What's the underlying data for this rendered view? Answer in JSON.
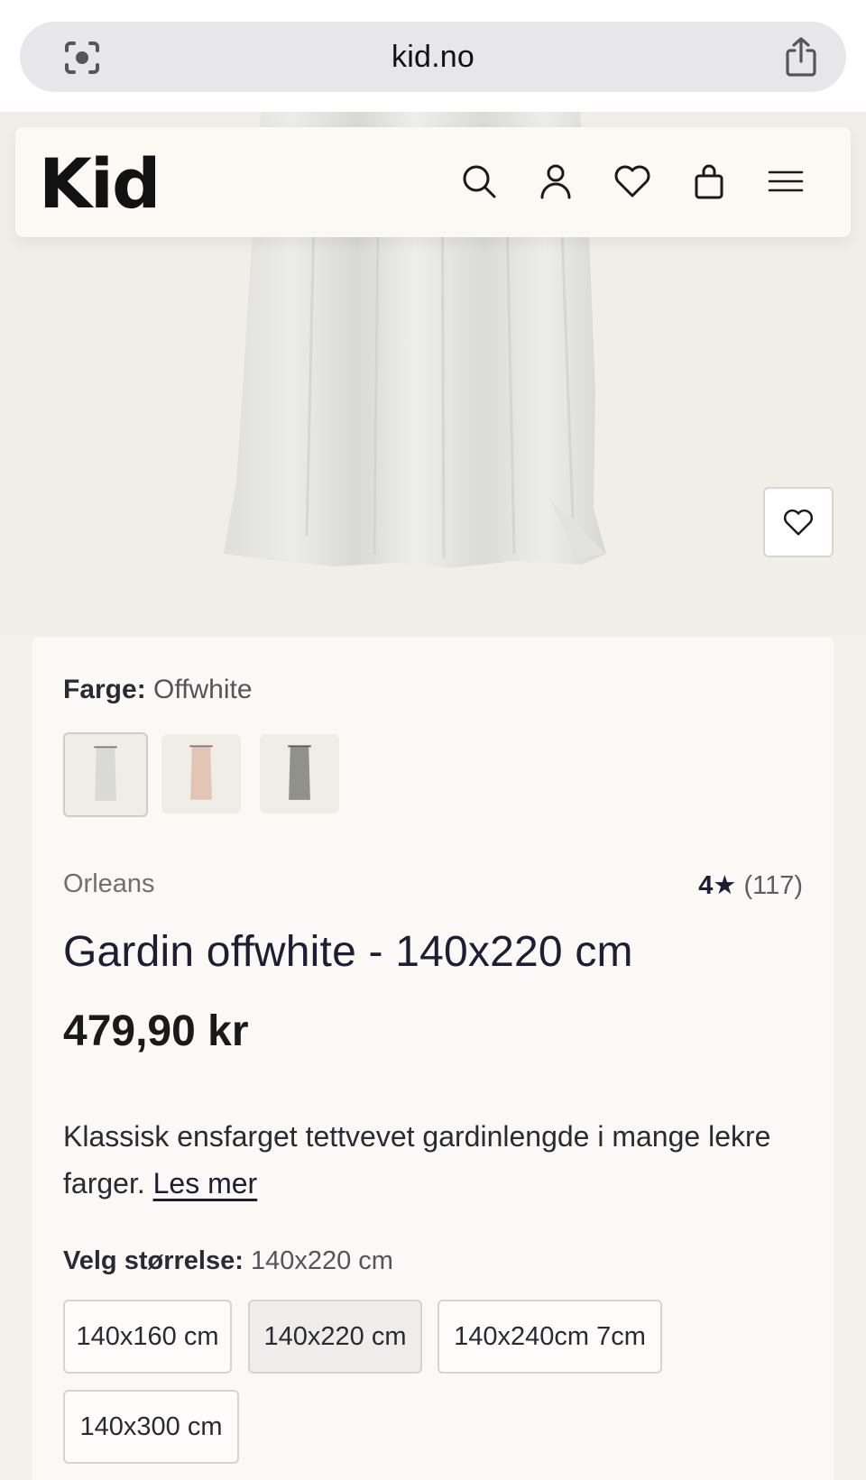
{
  "browser": {
    "url": "kid.no",
    "icons": [
      "lens-icon",
      "share-icon"
    ]
  },
  "header": {
    "logo": "Kid",
    "icons": [
      "search-icon",
      "account-icon",
      "heart-icon",
      "bag-icon",
      "menu-icon"
    ]
  },
  "product": {
    "color_label": "Farge:",
    "color_value": "Offwhite",
    "swatches": [
      {
        "name": "Offwhite",
        "color": "#d9dad6",
        "selected": true
      },
      {
        "name": "Rosa",
        "color": "#e4c4b4",
        "selected": false
      },
      {
        "name": "Grå",
        "color": "#8f918a",
        "selected": false
      }
    ],
    "brand": "Orleans",
    "rating_value": "4★",
    "rating_count": "(117)",
    "title": "Gardin offwhite - 140x220 cm",
    "price": "479,90 kr",
    "description": "Klassisk ensfarget tettvevet gardinlengde i mange lekre farger.",
    "read_more": "Les mer",
    "size_label": "Velg størrelse:",
    "size_value": "140x220 cm",
    "sizes": [
      "140x160 cm",
      "140x220 cm",
      "140x240cm 7cm",
      "140x300 cm"
    ],
    "selected_size_index": 1
  },
  "colors": {
    "page_bg": "#f3f0ea",
    "card_bg": "#faf9f6",
    "text": "#1e1d33"
  }
}
